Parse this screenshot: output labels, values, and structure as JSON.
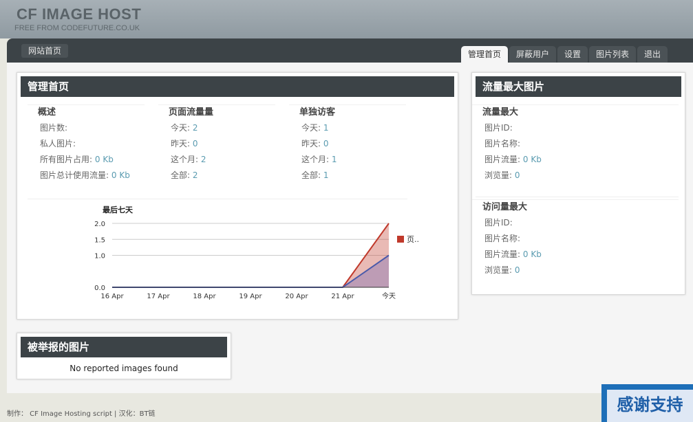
{
  "header": {
    "title": "CF IMAGE HOST",
    "subtitle": "FREE FROM CODEFUTURE.CO.UK"
  },
  "nav": {
    "home_link": "网站首页",
    "tabs": [
      {
        "label": "管理首页",
        "active": true
      },
      {
        "label": "屏蔽用户",
        "active": false
      },
      {
        "label": "设置",
        "active": false
      },
      {
        "label": "图片列表",
        "active": false
      },
      {
        "label": "退出",
        "active": false
      }
    ]
  },
  "admin": {
    "title": "管理首页",
    "overview": {
      "heading": "概述",
      "rows": [
        {
          "label": "图片数:",
          "value": ""
        },
        {
          "label": "私人图片:",
          "value": ""
        },
        {
          "label": "所有图片占用:",
          "value": "0 Kb"
        },
        {
          "label": "图片总计使用流量:",
          "value": "0 Kb"
        }
      ]
    },
    "pageviews": {
      "heading": "页面流量量",
      "rows": [
        {
          "label": "今天:",
          "value": "2"
        },
        {
          "label": "昨天:",
          "value": "0"
        },
        {
          "label": "这个月:",
          "value": "2"
        },
        {
          "label": "全部:",
          "value": "2"
        }
      ]
    },
    "visitors": {
      "heading": "单独访客",
      "rows": [
        {
          "label": "今天:",
          "value": "1"
        },
        {
          "label": "昨天:",
          "value": "0"
        },
        {
          "label": "这个月:",
          "value": "1"
        },
        {
          "label": "全部:",
          "value": "1"
        }
      ]
    }
  },
  "chart_data": {
    "type": "area",
    "title": "最后七天",
    "categories": [
      "16 Apr",
      "17 Apr",
      "18 Apr",
      "19 Apr",
      "20 Apr",
      "21 Apr",
      "今天"
    ],
    "series": [
      {
        "name": "页...",
        "values": [
          0,
          0,
          0,
          0,
          0,
          0,
          2
        ],
        "color": "#c0392b"
      },
      {
        "values": [
          0,
          0,
          0,
          0,
          0,
          0,
          1
        ],
        "color": "#4a5aaa"
      }
    ],
    "yticks": [
      "0.0",
      "1.0",
      "1.5",
      "2.0"
    ],
    "ylim": [
      0,
      2
    ],
    "grid": true,
    "legend": "right"
  },
  "top_images": {
    "title": "流量最大图片",
    "most_traffic": {
      "heading": "流量最大",
      "rows": [
        {
          "label": "图片ID:",
          "value": ""
        },
        {
          "label": "图片名称:",
          "value": ""
        },
        {
          "label": "图片流量:",
          "value": "0 Kb"
        },
        {
          "label": "浏览量:",
          "value": "0"
        }
      ]
    },
    "most_views": {
      "heading": "访问量最大",
      "rows": [
        {
          "label": "图片ID:",
          "value": ""
        },
        {
          "label": "图片名称:",
          "value": ""
        },
        {
          "label": "图片流量:",
          "value": "0 Kb"
        },
        {
          "label": "浏览量:",
          "value": "0"
        }
      ]
    }
  },
  "reported": {
    "title": "被举报的图片",
    "message": "No reported images found"
  },
  "footer": {
    "text": "制作： CF Image Hosting script | 汉化：BT链"
  },
  "badge": {
    "text": "感谢支持"
  }
}
